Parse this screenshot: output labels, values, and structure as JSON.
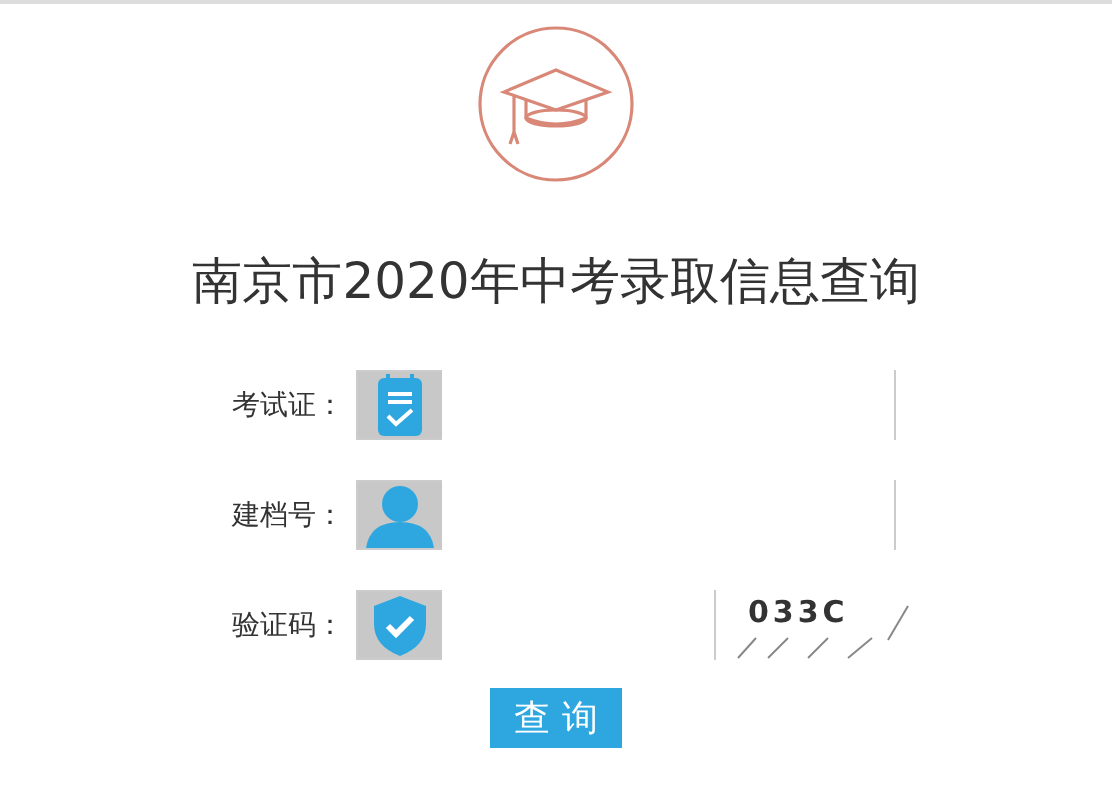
{
  "title": "南京市2020年中考录取信息查询",
  "fields": [
    {
      "kind": "ticket",
      "label": "考试证："
    },
    {
      "kind": "person",
      "label": "建档号："
    },
    {
      "kind": "code",
      "label": "验证码：",
      "captcha": "033C"
    }
  ],
  "button": "查 询"
}
